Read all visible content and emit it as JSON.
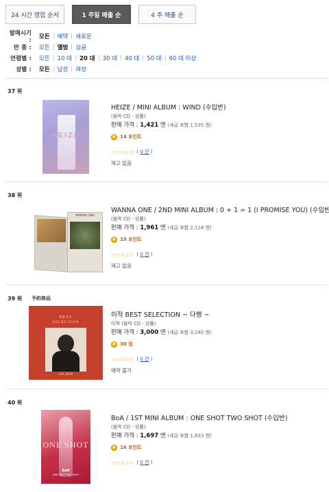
{
  "tabs": [
    {
      "label": "24 시간 영업 순서",
      "active": false
    },
    {
      "label": "1 주일 매출 순",
      "active": true
    },
    {
      "label": "4 주 매출 순",
      "active": false
    }
  ],
  "filters": {
    "release": {
      "label": "발매시기 :",
      "options": [
        "모든",
        "예약",
        "새로운"
      ]
    },
    "type": {
      "label": "반 종 :",
      "options": [
        "모든",
        "앨범",
        "싱글"
      ]
    },
    "age": {
      "label": "연령별 :",
      "options": [
        "모든",
        "10 대",
        "20 대",
        "30 대",
        "40 대",
        "50 대",
        "60 대 이상"
      ]
    },
    "gender": {
      "label": "성별 :",
      "options": [
        "모든",
        "남성",
        "여성"
      ]
    }
  },
  "price_label": "판매 가격 :",
  "yen": "엔",
  "items": [
    {
      "rank": "37 위",
      "title": "HEIZE / MINI ALBUM : WIND (수입반)",
      "media": "(음악 CD · 상품)",
      "price": "1,421",
      "tax": "(세금 포함 1,535  엔)",
      "points": "14 포인트",
      "stars": "☆☆☆☆☆",
      "reviews": "0 건",
      "stock": "재고 없음"
    },
    {
      "rank": "38 위",
      "title": "WANNA ONE / 2ND MINI ALBUM : 0 + 1 = 1 (I PROMISE YOU) (수입반)",
      "media": "(음악 CD · 상품)",
      "price": "1,961",
      "tax": "(세금 포함 2,118  엔)",
      "points": "19 포인트",
      "stars": "☆☆☆☆☆",
      "reviews": "0 건",
      "stock": "재고 없음"
    },
    {
      "rank": "39 위",
      "badge": "予約商品",
      "title": "이적 BEST SELECTION ~ 다행 ~",
      "media": "이적 (음악 CD · 상품)",
      "price": "3,000",
      "tax": "(세금 포함 3,240  엔)",
      "points": "30 점",
      "stars": "☆☆☆☆☆",
      "reviews": "0 건",
      "stock": "예약 불가"
    },
    {
      "rank": "40 위",
      "title": "BoA / 1ST MINI ALBUM : ONE SHOT TWO SHOT (수입반)",
      "media": "(음악 CD · 상품)",
      "price": "1,697",
      "tax": "(세금 포함 1,833  엔)",
      "points": "16 포인트",
      "stars": "☆☆☆☆☆",
      "reviews": "0 건"
    }
  ],
  "cover_text": {
    "heize": "HEIZE",
    "wannaone": "WANNA ONE",
    "ijeok_top": "BEST",
    "ijeok_sub": "SELECTION",
    "ijeok_bottom": "LEE JUCK",
    "boa_main": "ONE SHOT",
    "boa_sub": "BoA",
    "boa_line": "ONE SHOT TWO SHOT"
  },
  "colors": {
    "link": "#1d5ab8",
    "point": "#f0b400",
    "star": "#e8a300",
    "active_tab": "#5a5a5a"
  }
}
